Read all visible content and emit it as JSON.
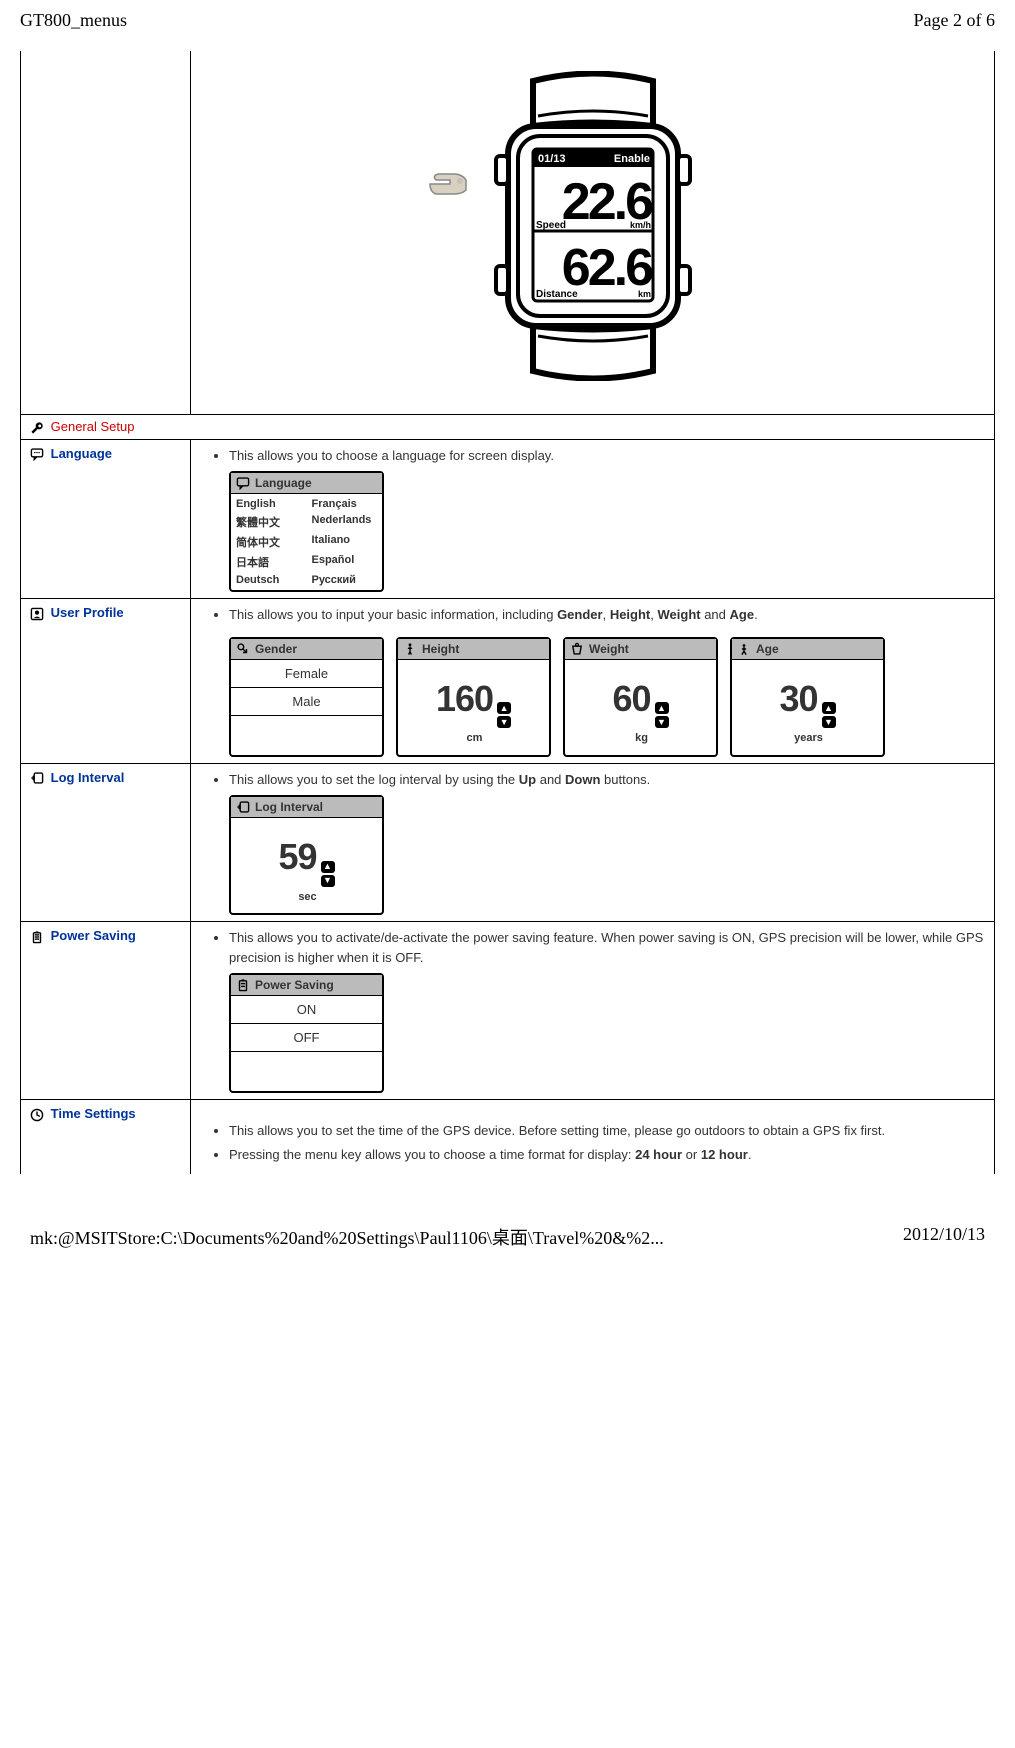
{
  "header": {
    "title": "GT800_menus",
    "page": "Page 2 of 6"
  },
  "footer": {
    "path": "mk:@MSITStore:C:\\Documents%20and%20Settings\\Paul1106\\桌面\\Travel%20&%2...",
    "date": "2012/10/13"
  },
  "watch": {
    "status_left": "01/13",
    "status_right": "Enable",
    "speed_label": "Speed",
    "speed_value": "22.6",
    "speed_unit": "km/h",
    "distance_label": "Distance",
    "distance_value": "62.6",
    "distance_unit": "km"
  },
  "sections": {
    "general_setup": "General Setup",
    "language": {
      "label": "Language",
      "bullet": "This allows you to choose a language for screen display.",
      "screen_title": "Language",
      "options": [
        "English",
        "Français",
        "繁體中文",
        "Nederlands",
        "简体中文",
        "Italiano",
        "日本語",
        "Español",
        "Deutsch",
        "Русский"
      ]
    },
    "user_profile": {
      "label": "User Profile",
      "bullet_prefix": "This allows you to input your basic information, including ",
      "bold1": "Gender",
      "sep1": ", ",
      "bold2": "Height",
      "sep2": ", ",
      "bold3": "Weight",
      "sep3": " and ",
      "bold4": "Age",
      "suffix": ".",
      "gender": {
        "title": "Gender",
        "female": "Female",
        "male": "Male"
      },
      "height": {
        "title": "Height",
        "value": "160",
        "unit": "cm"
      },
      "weight": {
        "title": "Weight",
        "value": "60",
        "unit": "kg"
      },
      "age": {
        "title": "Age",
        "value": "30",
        "unit": "years"
      }
    },
    "log_interval": {
      "label": "Log Interval",
      "bullet_prefix": "This allows you to set the log interval by using the ",
      "bold1": "Up",
      "sep1": " and ",
      "bold2": "Down",
      "suffix": " buttons.",
      "screen_title": "Log Interval",
      "value": "59",
      "unit": "sec"
    },
    "power_saving": {
      "label": "Power Saving",
      "bullet": "This allows you to activate/de-activate the power saving feature. When power saving is ON, GPS precision will be lower, while GPS precision is higher when it is OFF.",
      "screen_title": "Power Saving",
      "on": "ON",
      "off": "OFF"
    },
    "time_settings": {
      "label": "Time Settings",
      "bullet1": "This allows you to set the time of the GPS device. Before setting time, please go outdoors to obtain a GPS fix first.",
      "bullet2_prefix": "Pressing the menu key allows you to choose a time format for display: ",
      "bold1": "24 hour",
      "sep1": " or ",
      "bold2": "12 hour",
      "suffix": "."
    }
  }
}
